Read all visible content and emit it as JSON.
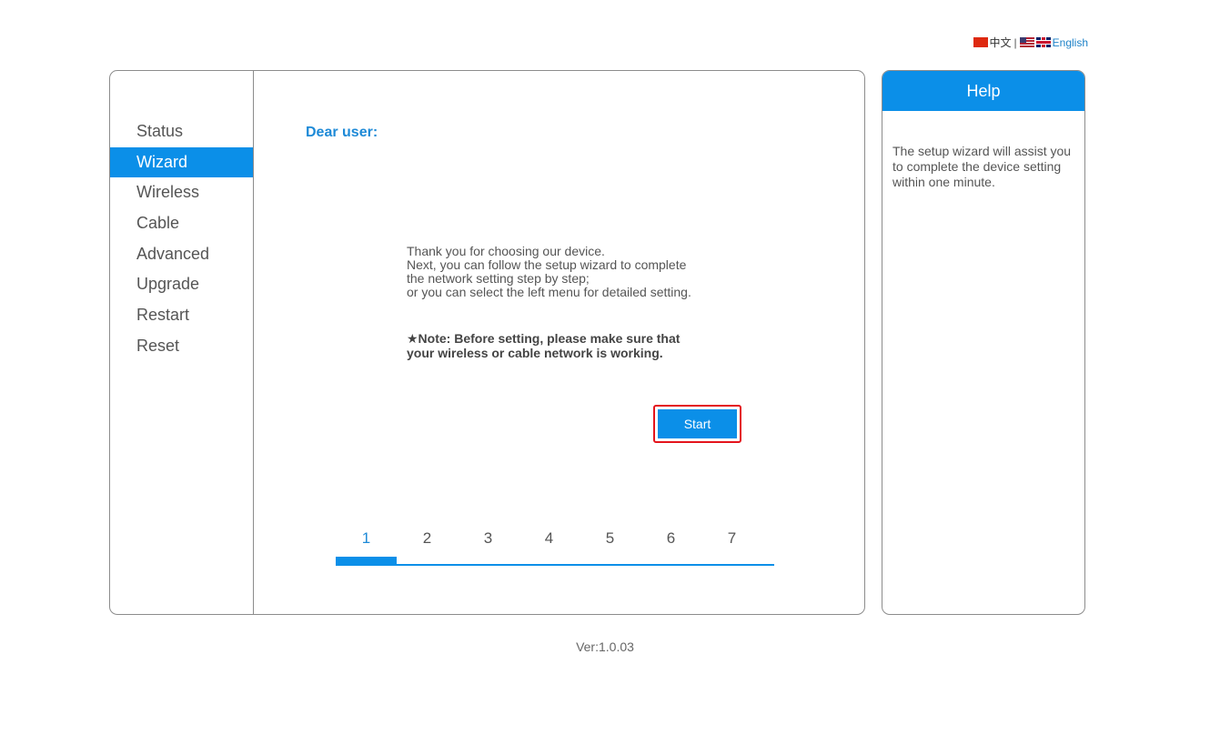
{
  "language_bar": {
    "chinese_label": "中文",
    "separator": "|",
    "english_label": "English"
  },
  "sidebar": {
    "items": [
      {
        "label": "Status",
        "active": false
      },
      {
        "label": "Wizard",
        "active": true
      },
      {
        "label": "Wireless",
        "active": false
      },
      {
        "label": "Cable",
        "active": false
      },
      {
        "label": "Advanced",
        "active": false
      },
      {
        "label": "Upgrade",
        "active": false
      },
      {
        "label": "Restart",
        "active": false
      },
      {
        "label": "Reset",
        "active": false
      }
    ]
  },
  "main": {
    "greeting": "Dear user:",
    "intro_lines": [
      "Thank you for choosing our device.",
      "Next, you can follow the setup wizard to complete",
      "the network setting step by step;",
      "or you can select the left menu for detailed setting."
    ],
    "note_lines": [
      "★Note: Before setting, please make sure that",
      "your wireless or cable network is working."
    ],
    "start_button": "Start",
    "steps": [
      "1",
      "2",
      "3",
      "4",
      "5",
      "6",
      "7"
    ],
    "current_step": 1
  },
  "help": {
    "title": "Help",
    "text": "The setup wizard will assist you to complete the device setting within one minute."
  },
  "footer": {
    "version": "Ver:1.0.03"
  },
  "colors": {
    "accent": "#0b8fe8",
    "highlight_border": "#e4141c",
    "greeting": "#1e8ad7"
  }
}
